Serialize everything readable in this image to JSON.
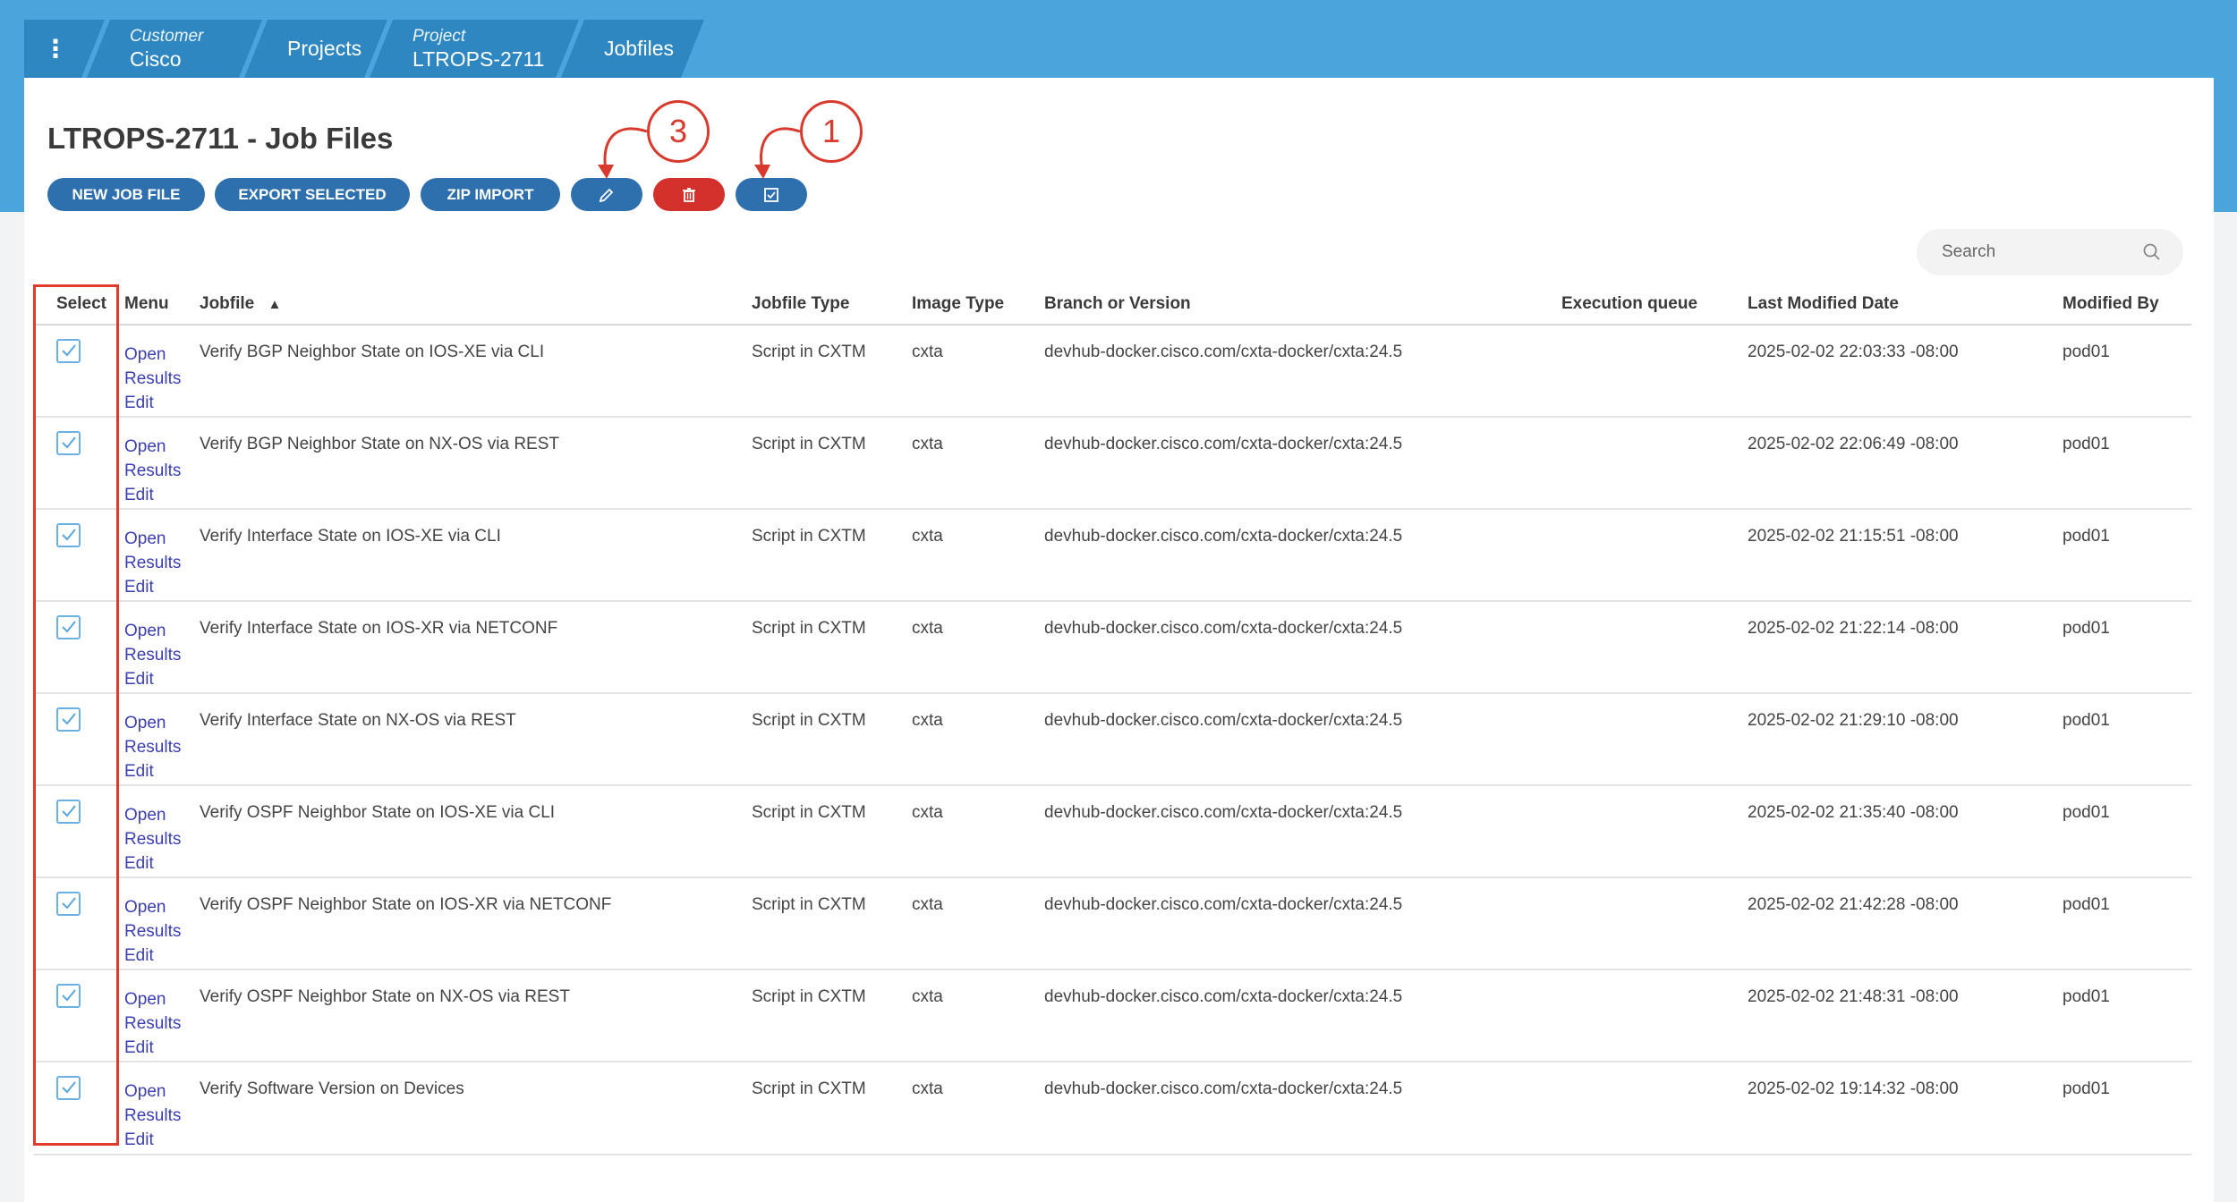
{
  "breadcrumb": {
    "menu_icon": "kebab-menu-icon",
    "customer_label": "Customer",
    "customer_value": "Cisco",
    "projects": "Projects",
    "project_label": "Project",
    "project_value": "LTROPS-2711",
    "jobfiles": "Jobfiles"
  },
  "page": {
    "title": "LTROPS-2711 - Job Files"
  },
  "toolbar": {
    "new_job_file": "NEW JOB FILE",
    "export_selected": "EXPORT SELECTED",
    "zip_import": "ZIP IMPORT",
    "edit_icon": "pencil-icon",
    "delete_icon": "trash-icon",
    "select_icon": "checkbox-icon"
  },
  "search": {
    "placeholder": "Search",
    "icon": "search-icon"
  },
  "annotations": {
    "callout_a": "3",
    "callout_b": "1",
    "color": "#d93a2e"
  },
  "table": {
    "columns": {
      "select": "Select",
      "menu": "Menu",
      "jobfile": "Jobfile",
      "jobfile_sort": "▲",
      "jobfile_type": "Jobfile Type",
      "image_type": "Image Type",
      "branch": "Branch or Version",
      "execution_queue": "Execution queue",
      "last_modified": "Last Modified Date",
      "modified_by": "Modified By"
    },
    "menu_links": {
      "open": "Open",
      "results": "Results",
      "edit": "Edit"
    },
    "rows": [
      {
        "checked": true,
        "jobfile": "Verify BGP Neighbor State on IOS-XE via CLI",
        "type": "Script in CXTM",
        "image": "cxta",
        "branch": "devhub-docker.cisco.com/cxta-docker/cxta:24.5",
        "queue": "",
        "modified": "2025-02-02 22:03:33 -08:00",
        "by": "pod01"
      },
      {
        "checked": true,
        "jobfile": "Verify BGP Neighbor State on NX-OS via REST",
        "type": "Script in CXTM",
        "image": "cxta",
        "branch": "devhub-docker.cisco.com/cxta-docker/cxta:24.5",
        "queue": "",
        "modified": "2025-02-02 22:06:49 -08:00",
        "by": "pod01"
      },
      {
        "checked": true,
        "jobfile": "Verify Interface State on IOS-XE via CLI",
        "type": "Script in CXTM",
        "image": "cxta",
        "branch": "devhub-docker.cisco.com/cxta-docker/cxta:24.5",
        "queue": "",
        "modified": "2025-02-02 21:15:51 -08:00",
        "by": "pod01"
      },
      {
        "checked": true,
        "jobfile": "Verify Interface State on IOS-XR via NETCONF",
        "type": "Script in CXTM",
        "image": "cxta",
        "branch": "devhub-docker.cisco.com/cxta-docker/cxta:24.5",
        "queue": "",
        "modified": "2025-02-02 21:22:14 -08:00",
        "by": "pod01"
      },
      {
        "checked": true,
        "jobfile": "Verify Interface State on NX-OS via REST",
        "type": "Script in CXTM",
        "image": "cxta",
        "branch": "devhub-docker.cisco.com/cxta-docker/cxta:24.5",
        "queue": "",
        "modified": "2025-02-02 21:29:10 -08:00",
        "by": "pod01"
      },
      {
        "checked": true,
        "jobfile": "Verify OSPF Neighbor State on IOS-XE via CLI",
        "type": "Script in CXTM",
        "image": "cxta",
        "branch": "devhub-docker.cisco.com/cxta-docker/cxta:24.5",
        "queue": "",
        "modified": "2025-02-02 21:35:40 -08:00",
        "by": "pod01"
      },
      {
        "checked": true,
        "jobfile": "Verify OSPF Neighbor State on IOS-XR via NETCONF",
        "type": "Script in CXTM",
        "image": "cxta",
        "branch": "devhub-docker.cisco.com/cxta-docker/cxta:24.5",
        "queue": "",
        "modified": "2025-02-02 21:42:28 -08:00",
        "by": "pod01"
      },
      {
        "checked": true,
        "jobfile": "Verify OSPF Neighbor State on NX-OS via REST",
        "type": "Script in CXTM",
        "image": "cxta",
        "branch": "devhub-docker.cisco.com/cxta-docker/cxta:24.5",
        "queue": "",
        "modified": "2025-02-02 21:48:31 -08:00",
        "by": "pod01"
      },
      {
        "checked": true,
        "jobfile": "Verify Software Version on Devices",
        "type": "Script in CXTM",
        "image": "cxta",
        "branch": "devhub-docker.cisco.com/cxta-docker/cxta:24.5",
        "queue": "",
        "modified": "2025-02-02 19:14:32 -08:00",
        "by": "pod01"
      }
    ]
  }
}
